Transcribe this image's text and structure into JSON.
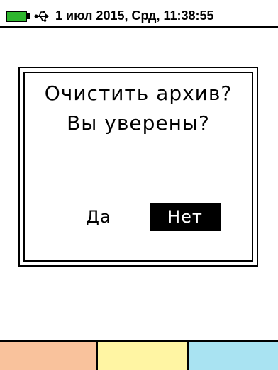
{
  "status_bar": {
    "battery_icon": "battery-icon",
    "battery_color": "#2db52d",
    "usb_icon": "usb-icon",
    "datetime": "1 июл 2015, Срд, 11:38:55"
  },
  "dialog": {
    "line1": "Очистить архив?",
    "line2": "Вы уверены?",
    "yes_label": "Да",
    "no_label": "Нет",
    "selected": "Нет"
  },
  "softkeys": [
    {
      "label": "",
      "color": "#f9c29c"
    },
    {
      "label": "",
      "color": "#fff5a3"
    },
    {
      "label": "",
      "color": "#a9e3f2"
    }
  ]
}
